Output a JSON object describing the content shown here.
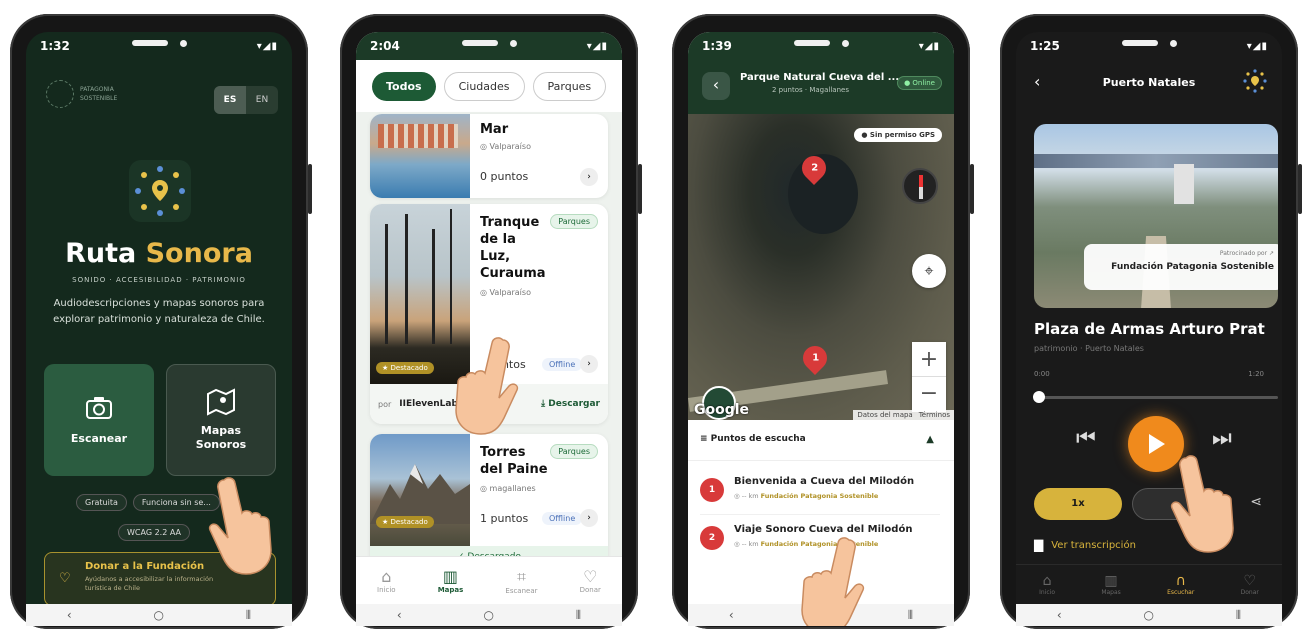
{
  "phones": {
    "p1": {
      "time": "1:32",
      "lang_es": "ES",
      "lang_en": "EN",
      "brand_1": "PATAGONIA",
      "brand_2": "SOSTENIBLE",
      "app_title_1": "Ruta",
      "app_title_2": "Sonora",
      "tagline": "SONIDO · ACCESIBILIDAD · PATRIMONIO",
      "description": "Audiodescripciones y mapas sonoros para explorar patrimonio y naturaleza de Chile.",
      "scan_label": "Escanear",
      "maps_label": "Mapas Sonoros",
      "chip_1": "Gratuita",
      "chip_2": "Funciona sin se...",
      "chip_3": "WCAG 2.2 AA",
      "donate_title": "Donar a la Fundación",
      "donate_sub": "Ayúdanos a accesibilizar la información turística de Chile"
    },
    "p2": {
      "time": "2:04",
      "filter_1": "Todos",
      "filter_2": "Ciudades",
      "filter_3": "Parques",
      "card1": {
        "title": "Mar",
        "location": "Valparaíso",
        "points": "0 puntos"
      },
      "card2": {
        "title": "Tranque de la Luz, Curauma",
        "location": "Valparaíso",
        "points": "puntos",
        "tag": "Parques",
        "badge": "★ Destacado",
        "offline": "Offline",
        "sponsor_by": "por",
        "sponsor": "IIElevenLabs",
        "download": "Descargar"
      },
      "card3": {
        "title": "Torres del Paine",
        "location": "magallanes",
        "points": "1 puntos",
        "tag": "Parques",
        "badge": "★ Destacado",
        "offline": "Offline"
      },
      "downloaded": "✓ Descargado",
      "nav_1": "Inicio",
      "nav_2": "Mapas",
      "nav_3": "Escanear",
      "nav_4": "Donar"
    },
    "p3": {
      "time": "1:39",
      "title": "Parque Natural Cueva del ...",
      "subtitle": "2 puntos · Magallanes",
      "online": "● Online",
      "gps": "● Sin permiso GPS",
      "google": "Google",
      "map_data": "Datos del mapa",
      "terms": "Términos",
      "points_title": "≡ Puntos de escucha",
      "item1": {
        "num": "1",
        "title": "Bienvenida a Cueva del Milodón",
        "meta": "◎ -- km",
        "org": "Fundación Patagonia Sostenible"
      },
      "item2": {
        "num": "2",
        "title": "Viaje Sonoro Cueva del Milodón",
        "meta": "◎ -- km",
        "org": "Fundación Patagonia Sostenible"
      },
      "marker_1": "1",
      "marker_2": "2"
    },
    "p4": {
      "time": "1:25",
      "title": "Puerto Natales",
      "sponsored_by": "Patrocinado por ↗",
      "sponsor": "Fundación Patagonia Sostenible",
      "track_title": "Plaza de Armas Arturo Prat",
      "track_meta": "patrimonio · Puerto Natales",
      "time_start": "0:00",
      "time_end": "1:20",
      "speed": "1x",
      "transcript": "Ver transcripción",
      "nav_1": "Inicio",
      "nav_2": "Mapas",
      "nav_3": "Escuchar",
      "nav_4": "Donar",
      "progress": 0.02
    }
  }
}
